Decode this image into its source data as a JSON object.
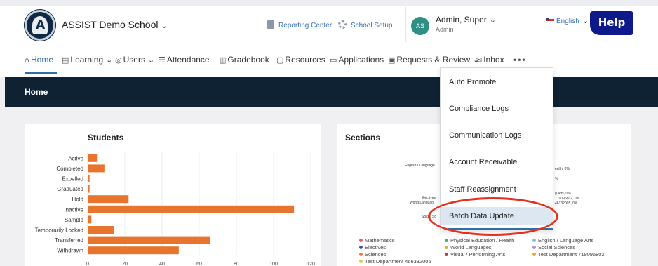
{
  "header": {
    "school_name": "ASSIST Demo School",
    "logo_letter": "A",
    "reporting_center": "Reporting Center",
    "school_setup": "School Setup",
    "avatar_initials": "AS",
    "user_name": "Admin, Super",
    "user_role": "Admin",
    "language": "English",
    "help": "Help"
  },
  "nav": {
    "home": "Home",
    "learning": "Learning",
    "users": "Users",
    "attendance": "Attendance",
    "gradebook": "Gradebook",
    "resources": "Resources",
    "applications": "Applications",
    "requests_review": "Requests & Review",
    "inbox": "Inbox",
    "more": "•••"
  },
  "banner": {
    "title": "Home"
  },
  "menu": {
    "items": [
      "Auto Promote",
      "Compliance Logs",
      "Communication Logs",
      "Account Receivable",
      "Staff Reassignment",
      "Batch Data Update"
    ]
  },
  "students": {
    "title": "Students",
    "chart_data": {
      "type": "bar",
      "orientation": "horizontal",
      "categories": [
        "Active",
        "Completed",
        "Expelled",
        "Graduated",
        "Hold",
        "Inactive",
        "Sample",
        "Temporarily Locked",
        "Transferred",
        "Withdrawn"
      ],
      "values": [
        5,
        9,
        1,
        1,
        22,
        111,
        2,
        14,
        66,
        49
      ],
      "xticks": [
        0,
        20,
        40,
        60,
        80,
        100,
        120
      ],
      "xlim": [
        0,
        120
      ],
      "color": "#e8752e"
    }
  },
  "sections": {
    "title": "Sections",
    "labels_left": [
      "English / Language",
      "Electives",
      "World Languag",
      "Social Sc"
    ],
    "labels_right": [
      "ealth, 0%",
      "%",
      "g Arts, 0%",
      "719096802, 0%",
      "46332005, 0%"
    ],
    "legend": [
      {
        "label": "Mathematics",
        "color": "#e4596b"
      },
      {
        "label": "Physical Education / Health",
        "color": "#4aab7c"
      },
      {
        "label": "English / Language Arts",
        "color": "#74c3e0"
      },
      {
        "label": "Electives",
        "color": "#3d4fa6"
      },
      {
        "label": "World Languages",
        "color": "#d6b33c"
      },
      {
        "label": "Social Sciences",
        "color": "#b28ad8"
      },
      {
        "label": "Sciences",
        "color": "#e37e3a"
      },
      {
        "label": "Visual / Performing Arts",
        "color": "#c23b3b"
      },
      {
        "label": "Test Department 719096802",
        "color": "#f0a23a"
      },
      {
        "label": "Test Department 466332005",
        "color": "#e6c54a"
      }
    ]
  }
}
